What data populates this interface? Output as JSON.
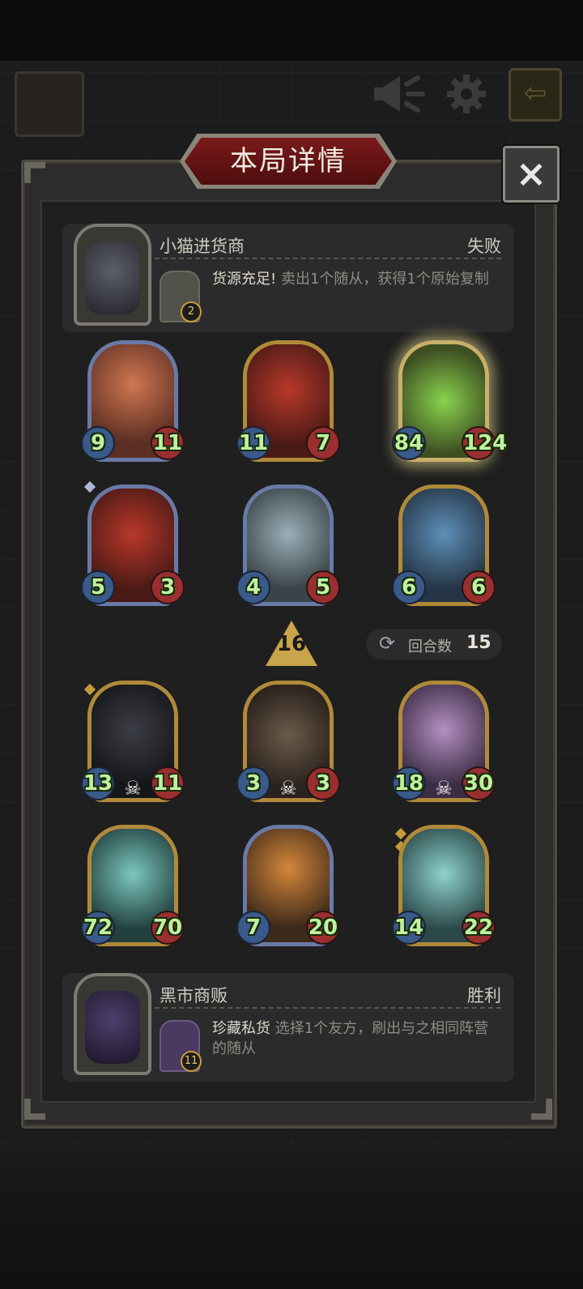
{
  "panel": {
    "title": "本局详情",
    "close_icon": "×"
  },
  "top_opponent": {
    "name": "小猫进货商",
    "result": "失败",
    "item_level": "2",
    "effect_title": "货源充足!",
    "effect_text": "卖出1个随从，获得1个原始复制"
  },
  "cards_top": [
    {
      "attack": "9",
      "health": "11",
      "frame": "blue"
    },
    {
      "attack": "11",
      "health": "7",
      "frame": "gold"
    },
    {
      "attack": "84",
      "health": "124",
      "frame": "glow"
    },
    {
      "attack": "5",
      "health": "3",
      "frame": "blue"
    },
    {
      "attack": "4",
      "health": "5",
      "frame": "blue"
    },
    {
      "attack": "6",
      "health": "6",
      "frame": "gold"
    }
  ],
  "tier_value": "16",
  "turns": {
    "label": "回合数",
    "value": "15"
  },
  "cards_bottom": [
    {
      "attack": "13",
      "health": "11",
      "frame": "gold"
    },
    {
      "attack": "3",
      "health": "3",
      "frame": "gold"
    },
    {
      "attack": "18",
      "health": "30",
      "frame": "gold"
    },
    {
      "attack": "72",
      "health": "70",
      "frame": "gold"
    },
    {
      "attack": "7",
      "health": "20",
      "frame": "blue"
    },
    {
      "attack": "14",
      "health": "22",
      "frame": "gold"
    }
  ],
  "bottom_opponent": {
    "name": "黑市商贩",
    "result": "胜利",
    "item_level": "11",
    "effect_title": "珍藏私货",
    "effect_text": "选择1个友方，刷出与之相同阵营的随从"
  },
  "colors": {
    "accent_gold": "#b08a3a",
    "title_red": "#7a1a1a",
    "stat_green": "#bff29e"
  },
  "icons": [
    "megaphone-icon",
    "gear-icon",
    "exit-icon",
    "close-icon",
    "refresh-icon",
    "skull-icon"
  ]
}
